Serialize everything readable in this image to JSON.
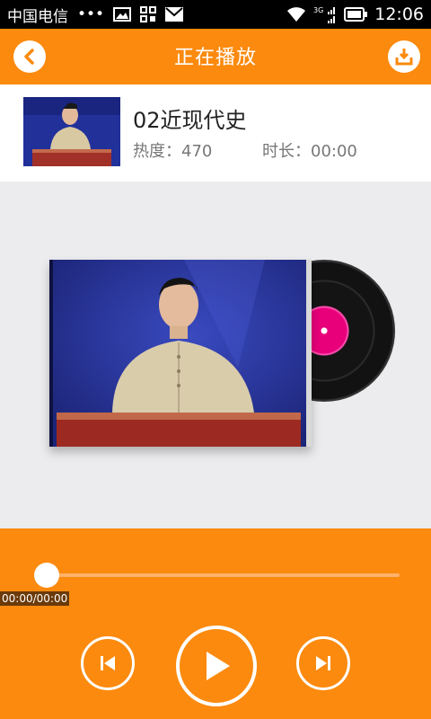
{
  "status_bar": {
    "carrier": "中国电信",
    "dots": "•••",
    "network": "3G",
    "time": "12:06"
  },
  "header": {
    "title": "正在播放"
  },
  "track": {
    "title": "02近现代史",
    "hot_label": "热度：470",
    "duration_label": "时长：00:00"
  },
  "player": {
    "time_text": "00:00/00:00",
    "progress": 0
  },
  "icons": {
    "back": "chevron-left-icon",
    "download": "download-icon",
    "prev": "skip-previous-icon",
    "play": "play-icon",
    "next": "skip-next-icon"
  },
  "colors": {
    "accent": "#fb8a0e",
    "background": "#ececef"
  }
}
